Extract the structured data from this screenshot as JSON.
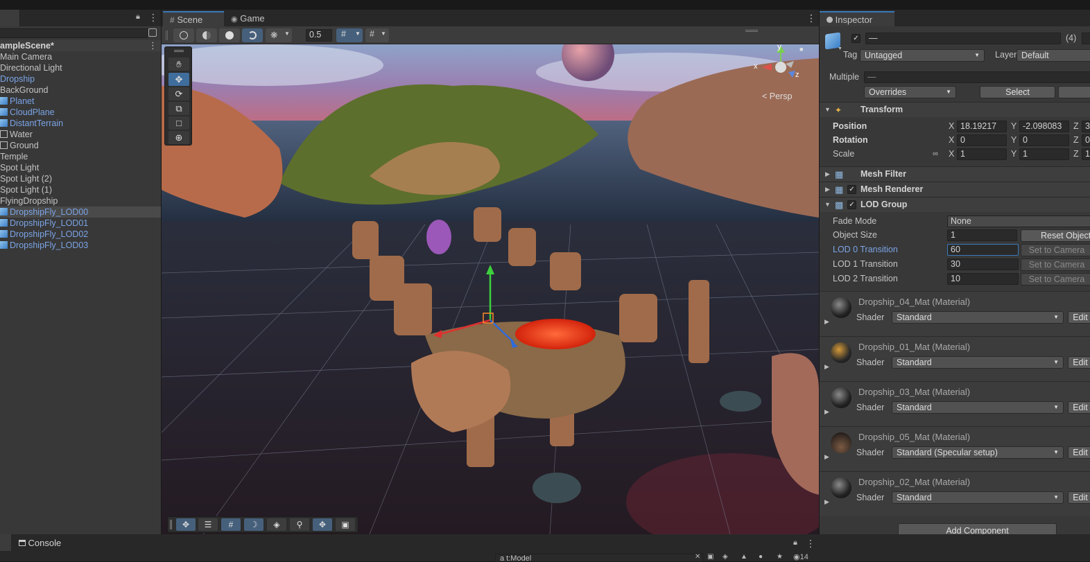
{
  "hierarchy": {
    "scene_name": "ampleScene*",
    "items": [
      {
        "label": "Main Camera",
        "prefab": false,
        "icon": ""
      },
      {
        "label": "Directional Light",
        "prefab": false,
        "icon": ""
      },
      {
        "label": "Dropship",
        "prefab": true,
        "icon": ""
      },
      {
        "label": "BackGround",
        "prefab": false,
        "icon": ""
      },
      {
        "label": "Planet",
        "prefab": true,
        "icon": "cube-icon"
      },
      {
        "label": "CloudPlane",
        "prefab": true,
        "icon": "cube-icon"
      },
      {
        "label": "DistantTerrain",
        "prefab": true,
        "icon": "cube-icon"
      },
      {
        "label": "Water",
        "prefab": false,
        "icon": "cube-outline-icon"
      },
      {
        "label": "Ground",
        "prefab": false,
        "icon": "cube-outline-icon"
      },
      {
        "label": "Temple",
        "prefab": false,
        "icon": ""
      },
      {
        "label": "Spot Light",
        "prefab": false,
        "icon": ""
      },
      {
        "label": "Spot Light (2)",
        "prefab": false,
        "icon": ""
      },
      {
        "label": "Spot Light (1)",
        "prefab": false,
        "icon": ""
      },
      {
        "label": "FlyingDropship",
        "prefab": false,
        "icon": ""
      },
      {
        "label": "DropshipFly_LOD00",
        "prefab": true,
        "icon": "cube-icon",
        "selected": true
      },
      {
        "label": "DropshipFly_LOD01",
        "prefab": true,
        "icon": "cube-icon"
      },
      {
        "label": "DropshipFly_LOD02",
        "prefab": true,
        "icon": "cube-icon"
      },
      {
        "label": "DropshipFly_LOD03",
        "prefab": true,
        "icon": "cube-icon"
      }
    ]
  },
  "scene": {
    "tabs": [
      {
        "label": "Scene",
        "icon": "grid-icon"
      },
      {
        "label": "Game",
        "icon": "gamepad-icon"
      }
    ],
    "grid_snap_value": "0.5",
    "camera_mode": "< Persp",
    "gizmo_axes": {
      "x": "x",
      "y": "y",
      "z": "z"
    }
  },
  "inspector": {
    "tab_label": "Inspector",
    "object_name": "—",
    "selection_count": "(4)",
    "tag_label": "Tag",
    "tag_value": "Untagged",
    "layer_label": "Layer",
    "layer_value": "Default",
    "multiple_label": "Multiple",
    "multiple_value": "—",
    "overrides_label": "Overrides",
    "select_label": "Select",
    "transform": {
      "title": "Transform",
      "position_label": "Position",
      "rotation_label": "Rotation",
      "scale_label": "Scale",
      "position": {
        "x": "18.19217",
        "y": "-2.098083",
        "z": "3"
      },
      "rotation": {
        "x": "0",
        "y": "0",
        "z": "0"
      },
      "scale": {
        "x": "1",
        "y": "1",
        "z": "1"
      }
    },
    "mesh_filter_title": "Mesh Filter",
    "mesh_renderer_title": "Mesh Renderer",
    "lod_group": {
      "title": "LOD Group",
      "fade_mode_label": "Fade Mode",
      "fade_mode_value": "None",
      "object_size_label": "Object Size",
      "object_size_value": "1",
      "reset_label": "Reset Object",
      "lod0_label": "LOD 0 Transition",
      "lod0_value": "60",
      "lod1_label": "LOD 1 Transition",
      "lod1_value": "30",
      "lod2_label": "LOD 2 Transition",
      "lod2_value": "10",
      "set_to_camera_label": "Set to Camera"
    },
    "shader_label": "Shader",
    "edit_label": "Edit",
    "materials": [
      {
        "name": "Dropship_04_Mat (Material)",
        "shader": "Standard"
      },
      {
        "name": "Dropship_01_Mat (Material)",
        "shader": "Standard"
      },
      {
        "name": "Dropship_03_Mat (Material)",
        "shader": "Standard"
      },
      {
        "name": "Dropship_05_Mat (Material)",
        "shader": "Standard (Specular setup)"
      },
      {
        "name": "Dropship_02_Mat (Material)",
        "shader": "Standard"
      }
    ],
    "add_component_label": "Add Component"
  },
  "bottom": {
    "console_label": "Console",
    "search_text": "a t:Model",
    "count_badge": "14"
  },
  "colors": {
    "prefab_blue": "#7ba4e6",
    "accent": "#3a79bb",
    "panel": "#383838"
  }
}
